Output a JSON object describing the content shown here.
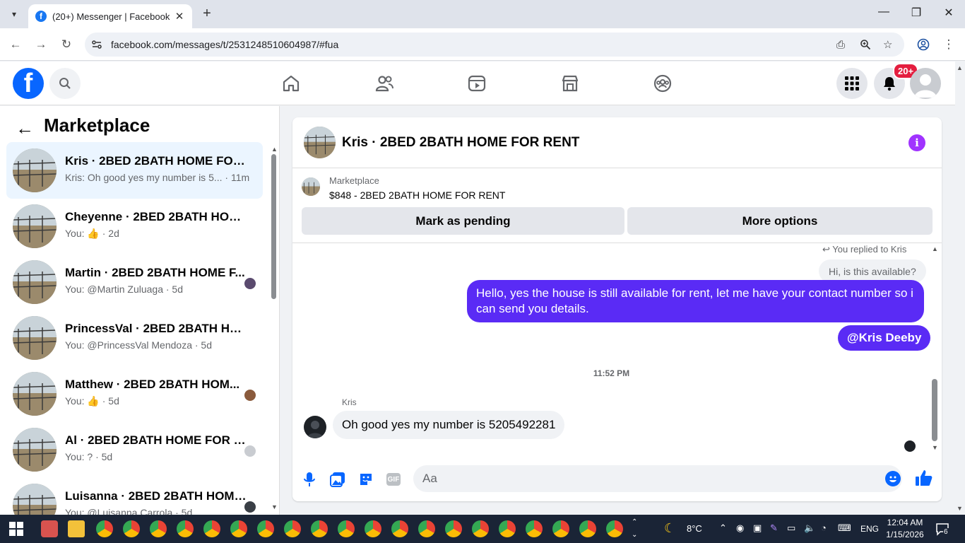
{
  "browser": {
    "tab_title": "(20+) Messenger | Facebook",
    "tab_close": "✕",
    "new_tab": "+",
    "url": "facebook.com/messages/t/2531248510604987/#fua"
  },
  "fb_header": {
    "logo_letter": "f",
    "notification_badge": "20+"
  },
  "left_panel": {
    "title": "Marketplace",
    "conversations": [
      {
        "name": "Kris · 2BED 2BATH HOME FOR R...",
        "sub": "Kris: Oh good yes my number is 5... · 11m"
      },
      {
        "name": "Cheyenne · 2BED 2BATH HOME ...",
        "sub": "You: 👍 · 2d"
      },
      {
        "name": "Martin · 2BED 2BATH HOME F...",
        "sub": "You: @Martin Zuluaga · 5d"
      },
      {
        "name": "PrincessVal · 2BED 2BATH HOME...",
        "sub": "You: @PrincessVal Mendoza · 5d"
      },
      {
        "name": "Matthew · 2BED 2BATH HOM...",
        "sub": "You: 👍 · 5d"
      },
      {
        "name": "Al · 2BED 2BATH HOME FOR R...",
        "sub": "You: ? · 5d"
      },
      {
        "name": "Luisanna · 2BED 2BATH HOME...",
        "sub": "You: @Luisanna Carrola · 5d"
      }
    ]
  },
  "chat": {
    "title": "Kris · 2BED 2BATH HOME FOR RENT",
    "marketplace_label": "Marketplace",
    "listing": "$848 - 2BED 2BATH HOME FOR RENT",
    "mark_pending": "Mark as pending",
    "more_options": "More options",
    "replied_to": "You replied to Kris",
    "quoted_message": "Hi, is this available?",
    "out_message_1": "Hello, yes the house is still available for rent, let me have your contact number so i can send you details.",
    "out_message_2": "@Kris Deeby",
    "timestamp": "11:52 PM",
    "sender_name": "Kris",
    "in_message": "Oh good yes my number is 5205492281",
    "input_placeholder": "Aa"
  },
  "taskbar": {
    "weather": "8°C",
    "language": "ENG",
    "time": "12:04 AM",
    "date": "1/15/2026",
    "notifications": "6"
  },
  "colors": {
    "fb_blue": "#0866ff",
    "message_purple": "#5a2bf5",
    "badge_red": "#e41e3f",
    "active_conv": "#ebf5ff"
  }
}
